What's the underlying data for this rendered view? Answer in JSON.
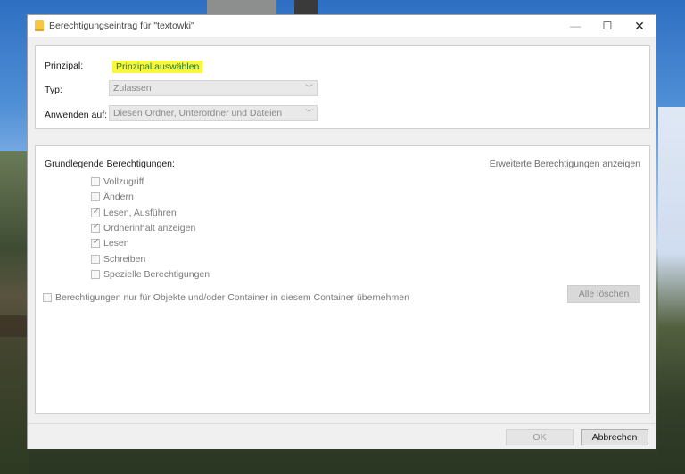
{
  "window": {
    "title": "Berechtigungseintrag für \"textowki\""
  },
  "top": {
    "principal_label": "Prinzipal:",
    "principal_link": "Prinzipal auswählen",
    "type_label": "Typ:",
    "type_value": "Zulassen",
    "apply_label": "Anwenden auf:",
    "apply_value": "Diesen Ordner, Unterordner und Dateien"
  },
  "permissions": {
    "heading": "Grundlegende Berechtigungen:",
    "advanced_link": "Erweiterte Berechtigungen anzeigen",
    "items": [
      {
        "label": "Vollzugriff",
        "checked": false
      },
      {
        "label": "Ändern",
        "checked": false
      },
      {
        "label": "Lesen, Ausführen",
        "checked": true
      },
      {
        "label": "Ordnerinhalt anzeigen",
        "checked": true
      },
      {
        "label": "Lesen",
        "checked": true
      },
      {
        "label": "Schreiben",
        "checked": false
      },
      {
        "label": "Spezielle Berechtigungen",
        "checked": false
      }
    ],
    "inherit_label": "Berechtigungen nur für Objekte und/oder Container in diesem Container übernehmen",
    "inherit_checked": false,
    "clear_button": "Alle löschen"
  },
  "footer": {
    "ok": "OK",
    "cancel": "Abbrechen"
  },
  "icons": {
    "minimize": "minimize-icon",
    "maximize": "maximize-icon",
    "close": "close-icon",
    "folder": "folder-icon",
    "chevron": "chevron-down-icon",
    "check": "check-icon"
  },
  "colors": {
    "highlight": "#f7f740",
    "link_text": "#2a7a2a"
  }
}
